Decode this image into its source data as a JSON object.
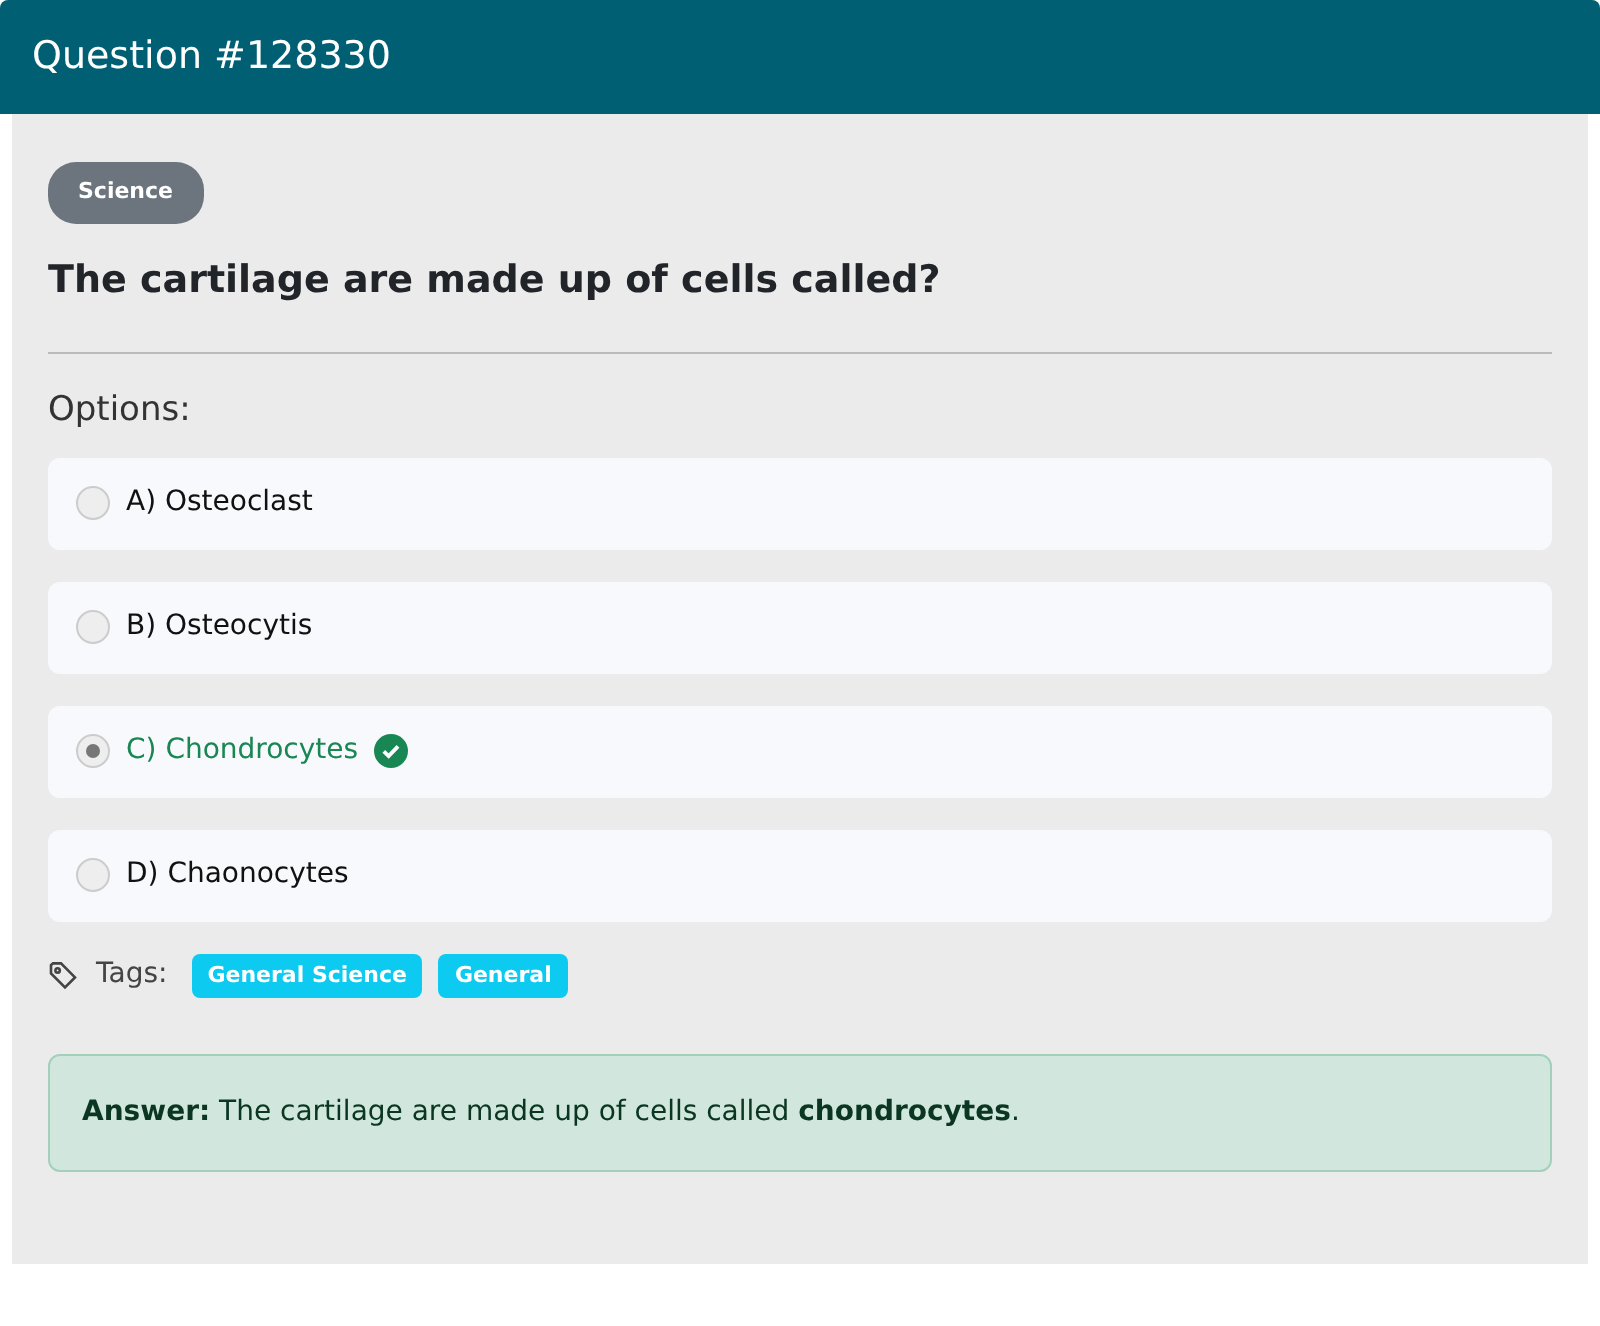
{
  "header": {
    "title": "Question #128330"
  },
  "category": "Science",
  "question": "The cartilage are made up of cells called?",
  "options_label": "Options:",
  "options": [
    {
      "label": "A) Osteoclast",
      "selected": false,
      "correct": false
    },
    {
      "label": "B) Osteocytis",
      "selected": false,
      "correct": false
    },
    {
      "label": "C) Chondrocytes",
      "selected": true,
      "correct": true
    },
    {
      "label": "D) Chaonocytes",
      "selected": false,
      "correct": false
    }
  ],
  "tags_label": "Tags:",
  "tags": [
    "General Science",
    "General"
  ],
  "answer": "**Answer:** The cartilage are made up of cells called **chondrocytes**."
}
